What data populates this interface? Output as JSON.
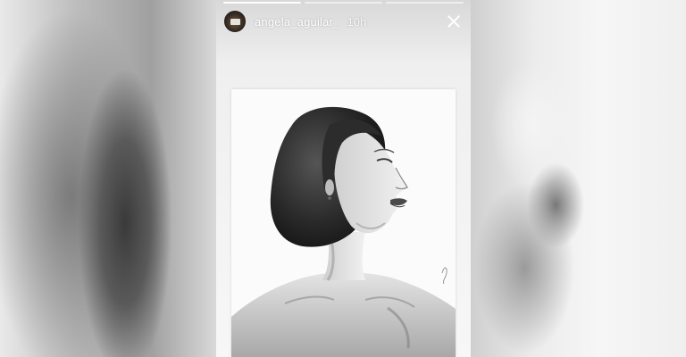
{
  "story": {
    "username": "angela_aguilar_",
    "time": "10h",
    "segments": 3,
    "active_segment": 1
  },
  "icons": {
    "avatar": "profile-avatar",
    "close": "close-icon"
  }
}
